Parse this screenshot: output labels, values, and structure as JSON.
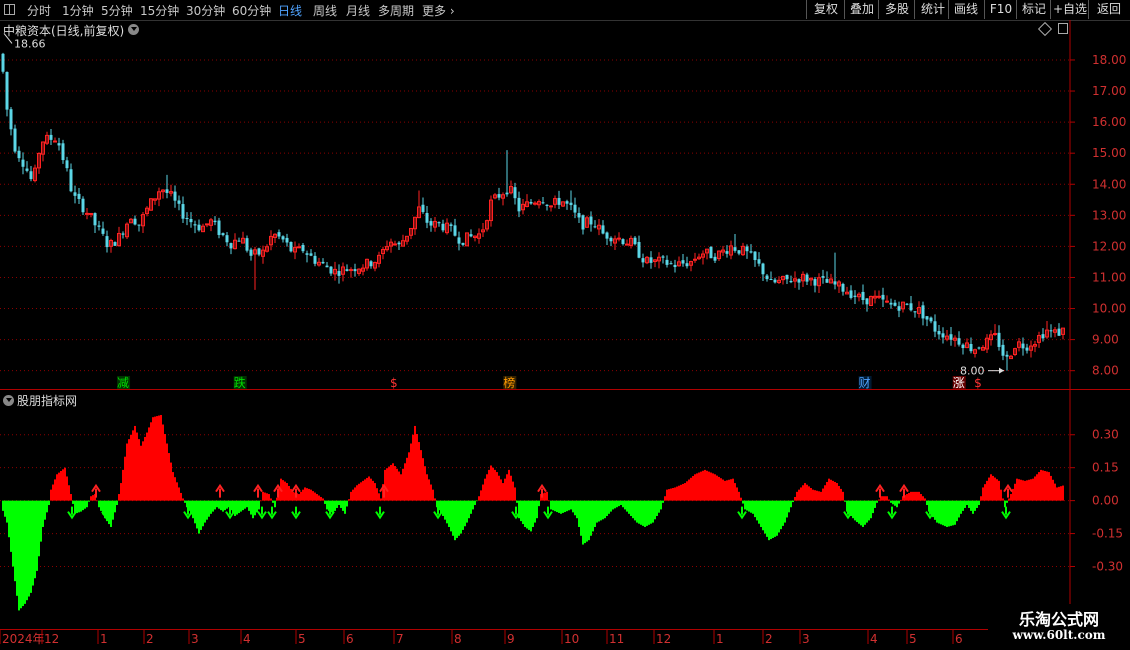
{
  "toolbar": {
    "timeframes": [
      "分时",
      "1分钟",
      "5分钟",
      "15分钟",
      "30分钟",
      "60分钟",
      "日线",
      "周线",
      "月线",
      "多周期",
      "更多"
    ],
    "active_timeframe": "日线",
    "buttons": [
      "复权",
      "叠加",
      "多股",
      "统计",
      "画线",
      "F10",
      "标记",
      "+自选",
      "返回"
    ]
  },
  "main_chart": {
    "title": "中粮资本(日线,前复权)",
    "high_label": "18.66",
    "low_label": "8.00",
    "events": [
      {
        "label": "减",
        "color": "#00dd00",
        "bg": "#003300",
        "pos": 0.115
      },
      {
        "label": "跌",
        "color": "#00dd00",
        "bg": "#003300",
        "pos": 0.224
      },
      {
        "label": "$",
        "color": "#ff3333",
        "bg": "#000000",
        "pos": 0.368
      },
      {
        "label": "榜",
        "color": "#ff9900",
        "bg": "#332200",
        "pos": 0.476
      },
      {
        "label": "财",
        "color": "#4fa3ff",
        "bg": "#001a33",
        "pos": 0.808
      },
      {
        "label": "涨",
        "color": "#ffffff",
        "bg": "#660000",
        "pos": 0.896
      },
      {
        "label": "$",
        "color": "#ff3333",
        "bg": "#000000",
        "pos": 0.914
      }
    ],
    "y_ticks": [
      "18.00",
      "17.00",
      "16.00",
      "15.00",
      "14.00",
      "13.00",
      "12.00",
      "11.00",
      "10.00",
      "9.00",
      "8.00"
    ]
  },
  "indicator": {
    "title": "股朋指标网",
    "y_ticks": [
      "0.30",
      "0.15",
      "0.00",
      "-0.15",
      "-0.30"
    ]
  },
  "x_axis": {
    "labels": [
      "2024年",
      "12",
      "1",
      "2",
      "3",
      "4",
      "5",
      "6",
      "7",
      "8",
      "9",
      "10",
      "11",
      "12",
      "1",
      "2",
      "3",
      "4",
      "5",
      "6"
    ]
  },
  "watermark": {
    "title": "乐淘公式网",
    "url": "www.60lt.com"
  },
  "colors": {
    "up": "#ff2222",
    "down": "#5cd6e6",
    "pos_bar": "#ff0000",
    "neg_bar": "#00ff00",
    "grid": "#8b0000",
    "axis": "#b00000"
  },
  "chart_data": {
    "type": "candlestick",
    "price_axis": {
      "min": 7.7,
      "max": 18.9
    },
    "price_path": [
      [
        0,
        18.2
      ],
      [
        6,
        16.4
      ],
      [
        14,
        15.2
      ],
      [
        24,
        14.6
      ],
      [
        32,
        14.0
      ],
      [
        40,
        15.4
      ],
      [
        56,
        15.5
      ],
      [
        66,
        14.4
      ],
      [
        72,
        13.6
      ],
      [
        84,
        13.2
      ],
      [
        96,
        12.6
      ],
      [
        108,
        12.0
      ],
      [
        118,
        12.3
      ],
      [
        130,
        13.0
      ],
      [
        138,
        12.7
      ],
      [
        148,
        13.3
      ],
      [
        160,
        13.9
      ],
      [
        170,
        13.6
      ],
      [
        180,
        13.1
      ],
      [
        190,
        12.8
      ],
      [
        200,
        12.6
      ],
      [
        210,
        12.8
      ],
      [
        220,
        12.4
      ],
      [
        230,
        12.1
      ],
      [
        240,
        12.3
      ],
      [
        250,
        11.7
      ],
      [
        262,
        11.8
      ],
      [
        272,
        12.4
      ],
      [
        282,
        12.2
      ],
      [
        292,
        11.8
      ],
      [
        302,
        11.9
      ],
      [
        312,
        11.6
      ],
      [
        322,
        11.4
      ],
      [
        334,
        11.2
      ],
      [
        350,
        11.3
      ],
      [
        364,
        11.4
      ],
      [
        378,
        11.6
      ],
      [
        388,
        12.2
      ],
      [
        398,
        12.0
      ],
      [
        408,
        12.5
      ],
      [
        418,
        13.2
      ],
      [
        428,
        12.7
      ],
      [
        440,
        12.7
      ],
      [
        450,
        12.5
      ],
      [
        460,
        12.2
      ],
      [
        470,
        12.3
      ],
      [
        480,
        12.4
      ],
      [
        490,
        13.4
      ],
      [
        500,
        13.7
      ],
      [
        508,
        13.9
      ],
      [
        518,
        13.2
      ],
      [
        530,
        13.4
      ],
      [
        540,
        13.6
      ],
      [
        550,
        13.3
      ],
      [
        560,
        13.5
      ],
      [
        570,
        13.2
      ],
      [
        580,
        12.7
      ],
      [
        592,
        12.8
      ],
      [
        602,
        12.4
      ],
      [
        615,
        12.3
      ],
      [
        630,
        12.1
      ],
      [
        645,
        11.5
      ],
      [
        660,
        11.5
      ],
      [
        675,
        11.4
      ],
      [
        690,
        11.5
      ],
      [
        700,
        11.8
      ],
      [
        715,
        11.7
      ],
      [
        730,
        12.0
      ],
      [
        745,
        11.8
      ],
      [
        760,
        11.3
      ],
      [
        770,
        10.8
      ],
      [
        785,
        10.9
      ],
      [
        800,
        11.0
      ],
      [
        815,
        10.9
      ],
      [
        830,
        10.8
      ],
      [
        845,
        10.6
      ],
      [
        860,
        10.3
      ],
      [
        875,
        10.3
      ],
      [
        890,
        10.1
      ],
      [
        905,
        10.1
      ],
      [
        920,
        9.9
      ],
      [
        935,
        9.3
      ],
      [
        950,
        9.1
      ],
      [
        962,
        8.9
      ],
      [
        972,
        8.7
      ],
      [
        985,
        8.9
      ],
      [
        995,
        9.1
      ],
      [
        1005,
        8.3
      ],
      [
        1015,
        8.9
      ],
      [
        1025,
        8.8
      ],
      [
        1035,
        9.0
      ],
      [
        1045,
        9.3
      ],
      [
        1055,
        9.2
      ],
      [
        1063,
        9.3
      ]
    ],
    "spikes": [
      [
        40,
        15.8
      ],
      [
        56,
        15.8
      ],
      [
        165,
        14.3
      ],
      [
        254,
        10.6
      ],
      [
        418,
        13.8
      ],
      [
        505,
        15.1
      ],
      [
        540,
        14.7
      ],
      [
        570,
        13.8
      ],
      [
        735,
        12.4
      ],
      [
        835,
        11.8
      ],
      [
        995,
        9.5
      ],
      [
        1005,
        8.0
      ],
      [
        1045,
        9.6
      ]
    ],
    "indicator_axis": {
      "min": -0.58,
      "max": 0.44
    },
    "indicator_path": [
      [
        0,
        -0.02
      ],
      [
        6,
        -0.1
      ],
      [
        12,
        -0.3
      ],
      [
        18,
        -0.5
      ],
      [
        24,
        -0.47
      ],
      [
        30,
        -0.42
      ],
      [
        36,
        -0.32
      ],
      [
        42,
        -0.12
      ],
      [
        48,
        -0.02
      ],
      [
        50,
        0.05
      ],
      [
        56,
        0.12
      ],
      [
        64,
        0.15
      ],
      [
        70,
        0.03
      ],
      [
        74,
        -0.06
      ],
      [
        80,
        -0.05
      ],
      [
        86,
        -0.03
      ],
      [
        90,
        0.02
      ],
      [
        94,
        0.03
      ],
      [
        98,
        -0.03
      ],
      [
        104,
        -0.08
      ],
      [
        110,
        -0.12
      ],
      [
        116,
        -0.02
      ],
      [
        120,
        0.08
      ],
      [
        126,
        0.26
      ],
      [
        134,
        0.34
      ],
      [
        140,
        0.25
      ],
      [
        146,
        0.31
      ],
      [
        152,
        0.38
      ],
      [
        160,
        0.39
      ],
      [
        166,
        0.26
      ],
      [
        172,
        0.13
      ],
      [
        178,
        0.06
      ],
      [
        182,
        0.01
      ],
      [
        186,
        -0.03
      ],
      [
        192,
        -0.08
      ],
      [
        198,
        -0.15
      ],
      [
        204,
        -0.1
      ],
      [
        210,
        -0.06
      ],
      [
        216,
        -0.03
      ],
      [
        222,
        -0.05
      ],
      [
        228,
        -0.03
      ],
      [
        234,
        -0.07
      ],
      [
        240,
        -0.05
      ],
      [
        246,
        -0.03
      ],
      [
        252,
        -0.08
      ],
      [
        258,
        -0.04
      ],
      [
        262,
        0.04
      ],
      [
        268,
        0.03
      ],
      [
        274,
        -0.03
      ],
      [
        280,
        0.1
      ],
      [
        286,
        0.08
      ],
      [
        292,
        0.04
      ],
      [
        298,
        0.03
      ],
      [
        304,
        0.06
      ],
      [
        310,
        0.05
      ],
      [
        316,
        0.03
      ],
      [
        322,
        0.01
      ],
      [
        326,
        -0.04
      ],
      [
        332,
        -0.06
      ],
      [
        338,
        -0.02
      ],
      [
        344,
        -0.06
      ],
      [
        350,
        0.04
      ],
      [
        356,
        0.07
      ],
      [
        362,
        0.09
      ],
      [
        368,
        0.11
      ],
      [
        374,
        0.08
      ],
      [
        380,
        0.01
      ],
      [
        384,
        0.14
      ],
      [
        392,
        0.17
      ],
      [
        400,
        0.12
      ],
      [
        408,
        0.22
      ],
      [
        414,
        0.34
      ],
      [
        420,
        0.23
      ],
      [
        426,
        0.12
      ],
      [
        432,
        0.05
      ],
      [
        436,
        -0.03
      ],
      [
        442,
        -0.07
      ],
      [
        448,
        -0.12
      ],
      [
        454,
        -0.18
      ],
      [
        460,
        -0.15
      ],
      [
        466,
        -0.1
      ],
      [
        472,
        -0.04
      ],
      [
        478,
        0.02
      ],
      [
        484,
        0.1
      ],
      [
        490,
        0.16
      ],
      [
        496,
        0.13
      ],
      [
        502,
        0.08
      ],
      [
        508,
        0.14
      ],
      [
        514,
        0.06
      ],
      [
        518,
        -0.08
      ],
      [
        524,
        -0.12
      ],
      [
        530,
        -0.14
      ],
      [
        536,
        -0.08
      ],
      [
        540,
        0.03
      ],
      [
        546,
        0.04
      ],
      [
        550,
        -0.04
      ],
      [
        560,
        -0.06
      ],
      [
        570,
        -0.04
      ],
      [
        576,
        -0.08
      ],
      [
        582,
        -0.2
      ],
      [
        588,
        -0.18
      ],
      [
        596,
        -0.1
      ],
      [
        604,
        -0.08
      ],
      [
        612,
        -0.04
      ],
      [
        620,
        -0.02
      ],
      [
        628,
        -0.06
      ],
      [
        636,
        -0.1
      ],
      [
        644,
        -0.12
      ],
      [
        652,
        -0.1
      ],
      [
        660,
        -0.04
      ],
      [
        666,
        0.05
      ],
      [
        674,
        0.06
      ],
      [
        684,
        0.08
      ],
      [
        694,
        0.12
      ],
      [
        704,
        0.14
      ],
      [
        714,
        0.12
      ],
      [
        724,
        0.09
      ],
      [
        732,
        0.1
      ],
      [
        738,
        0.04
      ],
      [
        744,
        -0.04
      ],
      [
        752,
        -0.06
      ],
      [
        760,
        -0.12
      ],
      [
        768,
        -0.18
      ],
      [
        776,
        -0.16
      ],
      [
        784,
        -0.1
      ],
      [
        790,
        -0.03
      ],
      [
        796,
        0.04
      ],
      [
        804,
        0.08
      ],
      [
        812,
        0.05
      ],
      [
        820,
        0.04
      ],
      [
        828,
        0.1
      ],
      [
        836,
        0.08
      ],
      [
        842,
        0.04
      ],
      [
        846,
        -0.05
      ],
      [
        854,
        -0.09
      ],
      [
        862,
        -0.12
      ],
      [
        870,
        -0.08
      ],
      [
        876,
        -0.01
      ],
      [
        880,
        0.02
      ],
      [
        886,
        0.02
      ],
      [
        890,
        -0.01
      ],
      [
        896,
        -0.03
      ],
      [
        902,
        0.02
      ],
      [
        910,
        0.04
      ],
      [
        918,
        0.04
      ],
      [
        924,
        0.01
      ],
      [
        928,
        -0.05
      ],
      [
        936,
        -0.1
      ],
      [
        946,
        -0.12
      ],
      [
        954,
        -0.11
      ],
      [
        960,
        -0.06
      ],
      [
        966,
        -0.02
      ],
      [
        972,
        -0.06
      ],
      [
        978,
        -0.02
      ],
      [
        982,
        0.06
      ],
      [
        990,
        0.12
      ],
      [
        998,
        0.09
      ],
      [
        1004,
        -0.03
      ],
      [
        1010,
        0.03
      ],
      [
        1016,
        0.1
      ],
      [
        1024,
        0.09
      ],
      [
        1032,
        0.1
      ],
      [
        1040,
        0.14
      ],
      [
        1048,
        0.13
      ],
      [
        1056,
        0.06
      ],
      [
        1063,
        0.07
      ]
    ],
    "signals": [
      {
        "x": 72,
        "dir": "down"
      },
      {
        "x": 96,
        "dir": "up"
      },
      {
        "x": 106,
        "dir": "down"
      },
      {
        "x": 188,
        "dir": "down"
      },
      {
        "x": 220,
        "dir": "up"
      },
      {
        "x": 230,
        "dir": "down"
      },
      {
        "x": 258,
        "dir": "up"
      },
      {
        "x": 262,
        "dir": "down"
      },
      {
        "x": 272,
        "dir": "down"
      },
      {
        "x": 278,
        "dir": "up"
      },
      {
        "x": 296,
        "dir": "down"
      },
      {
        "x": 296,
        "dir": "up"
      },
      {
        "x": 330,
        "dir": "down"
      },
      {
        "x": 380,
        "dir": "down"
      },
      {
        "x": 384,
        "dir": "up"
      },
      {
        "x": 438,
        "dir": "down"
      },
      {
        "x": 516,
        "dir": "down"
      },
      {
        "x": 542,
        "dir": "up"
      },
      {
        "x": 548,
        "dir": "down"
      },
      {
        "x": 742,
        "dir": "down"
      },
      {
        "x": 848,
        "dir": "down"
      },
      {
        "x": 880,
        "dir": "up"
      },
      {
        "x": 892,
        "dir": "down"
      },
      {
        "x": 904,
        "dir": "up"
      },
      {
        "x": 930,
        "dir": "down"
      },
      {
        "x": 1006,
        "dir": "down"
      },
      {
        "x": 1008,
        "dir": "up"
      }
    ]
  }
}
